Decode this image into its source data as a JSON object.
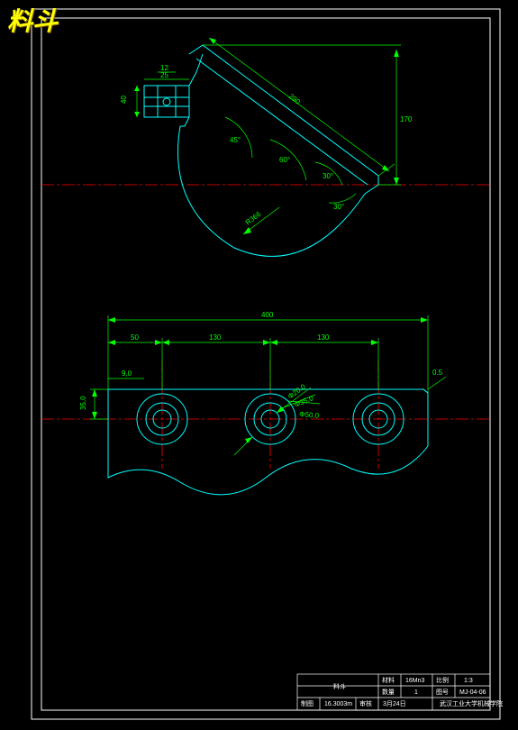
{
  "title": "料斗",
  "top_view": {
    "dims": {
      "slant_len": "290",
      "right_height": "170",
      "arc_radius": "R366",
      "angle1": "60°",
      "angle2": "30°",
      "angle3": "45°",
      "flange_h": "40",
      "flange_w": "25",
      "flange_gap": "12"
    }
  },
  "front_view": {
    "dims": {
      "overall_w": "400",
      "left_margin": "50",
      "pitch1": "130",
      "pitch2": "130",
      "edge_to_hole": "9,0",
      "height": "35,0",
      "chamfer": "0.5",
      "d_small": "Φ20.0",
      "d_mid": "Φ35.0",
      "d_large": "Φ50.0"
    }
  },
  "titleblock": {
    "name": "料斗",
    "material_lbl": "材料",
    "material": "16Mn3",
    "scale_lbl": "比例",
    "scale": "1:3",
    "qty_lbl": "数量",
    "qty": "1",
    "drawn_lbl": "图号",
    "drawn": "MJ-04-06",
    "weight_lbl": "制图",
    "weight": "16.3003m",
    "date_lbl": "审核",
    "date": "3月24日",
    "org": "武汉工业大学机械学院"
  }
}
